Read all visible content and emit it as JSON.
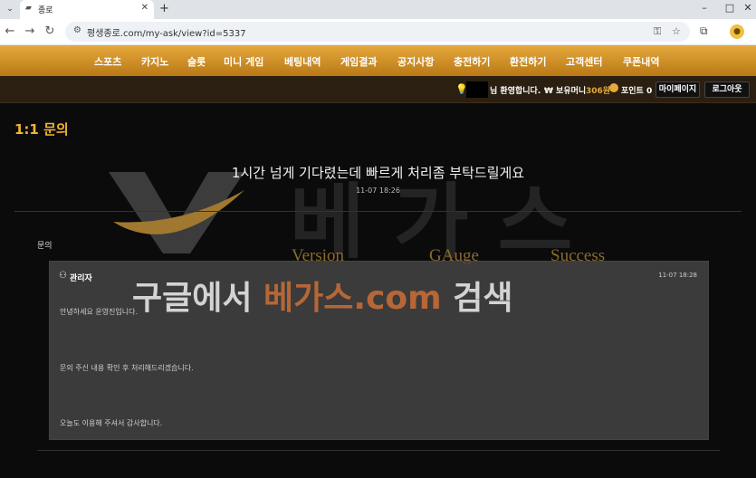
{
  "browser": {
    "tab_title": "종로",
    "url": "평생종로.com/my-ask/view?id=5337",
    "new_tab": "+",
    "minimize": "–",
    "maximize": "□",
    "close": "✕"
  },
  "nav": {
    "items": [
      "스포츠",
      "카지노",
      "슬롯",
      "미니 게임",
      "베팅내역",
      "게임결과",
      "공지사항",
      "충전하기",
      "환전하기",
      "고객센터",
      "쿠폰내역"
    ]
  },
  "userbar": {
    "welcome": "님 환영합니다.",
    "money_label": "₩ 보유머니",
    "money_value": "306원",
    "point_label": "포인트 0",
    "mypage_btn": "마이페이지",
    "logout_btn": "로그아웃"
  },
  "page": {
    "title": "1:1 문의",
    "ask_title": "1시간 넘게 기다렸는데 빠르게 처리좀 부탁드릴게요",
    "ask_date": "11-07 18:26",
    "section_label": "문의"
  },
  "reply": {
    "author": "관리자",
    "date": "11-07 18:28",
    "lines": [
      "안녕하세요 운영진입니다.",
      "문의 주신 내용 확인 후 처리해드리겠습니다.",
      "오늘도 이용해 주셔서 감사합니다."
    ]
  },
  "watermark": {
    "brand": "베가스",
    "words": [
      "Version",
      "GAuge",
      "Success"
    ],
    "banner_prefix": "구글에서",
    "banner_accent": "베가스.com",
    "banner_suffix": "검색"
  },
  "colors": {
    "accent": "#f0b435",
    "nav_gold": "#e6a93c"
  }
}
